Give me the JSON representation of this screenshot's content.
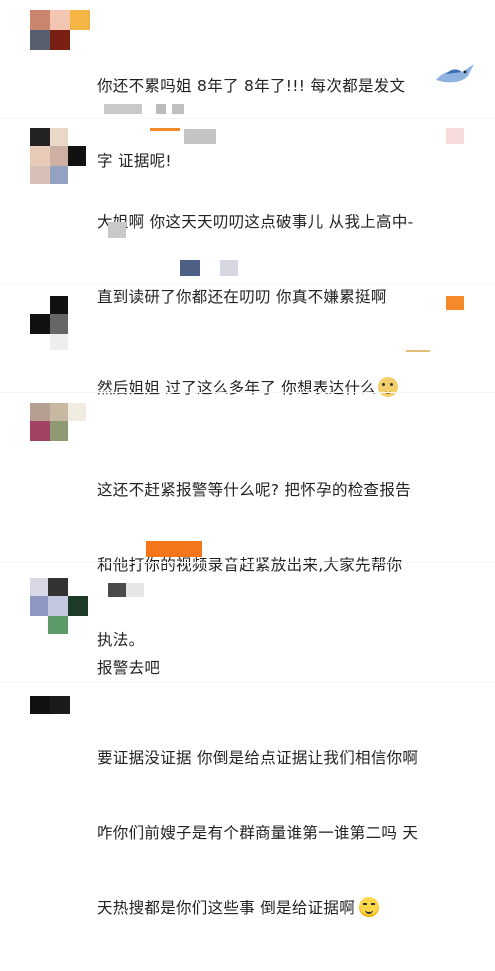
{
  "comments": [
    {
      "lines": [
        "你还不累吗姐 8年了 8年了!!!  每次都是发文",
        "字 证据呢!"
      ]
    },
    {
      "lines": [
        "大姐啊 你这天天叨叨这点破事儿 从我上高中-",
        "直到读研了你都还在叨叨 你真不嫌累挺啊"
      ]
    },
    {
      "lines": [
        "然后姐姐 过了这么多年了 你想表达什么"
      ],
      "emoji": "doge-emoji"
    },
    {
      "lines": [
        "这还不赶紧报警等什么呢? 把怀孕的检查报告",
        "和他打你的视频录音赶紧放出来,大家先帮你",
        "执法。"
      ]
    },
    {
      "lines": [
        "报警去吧"
      ]
    },
    {
      "lines": [
        "要证据没证据 你倒是给点证据让我们相信你啊",
        "咋你们前嫂子是有个群商量谁第一谁第二吗 天",
        "天热搜都是你们这些事 倒是给证据啊"
      ],
      "emoji": "wink-emoji"
    }
  ],
  "colors": {
    "text": "#222222",
    "mosaic_orange": "#f58a2a",
    "mosaic_gray": "#cfcfcf"
  }
}
